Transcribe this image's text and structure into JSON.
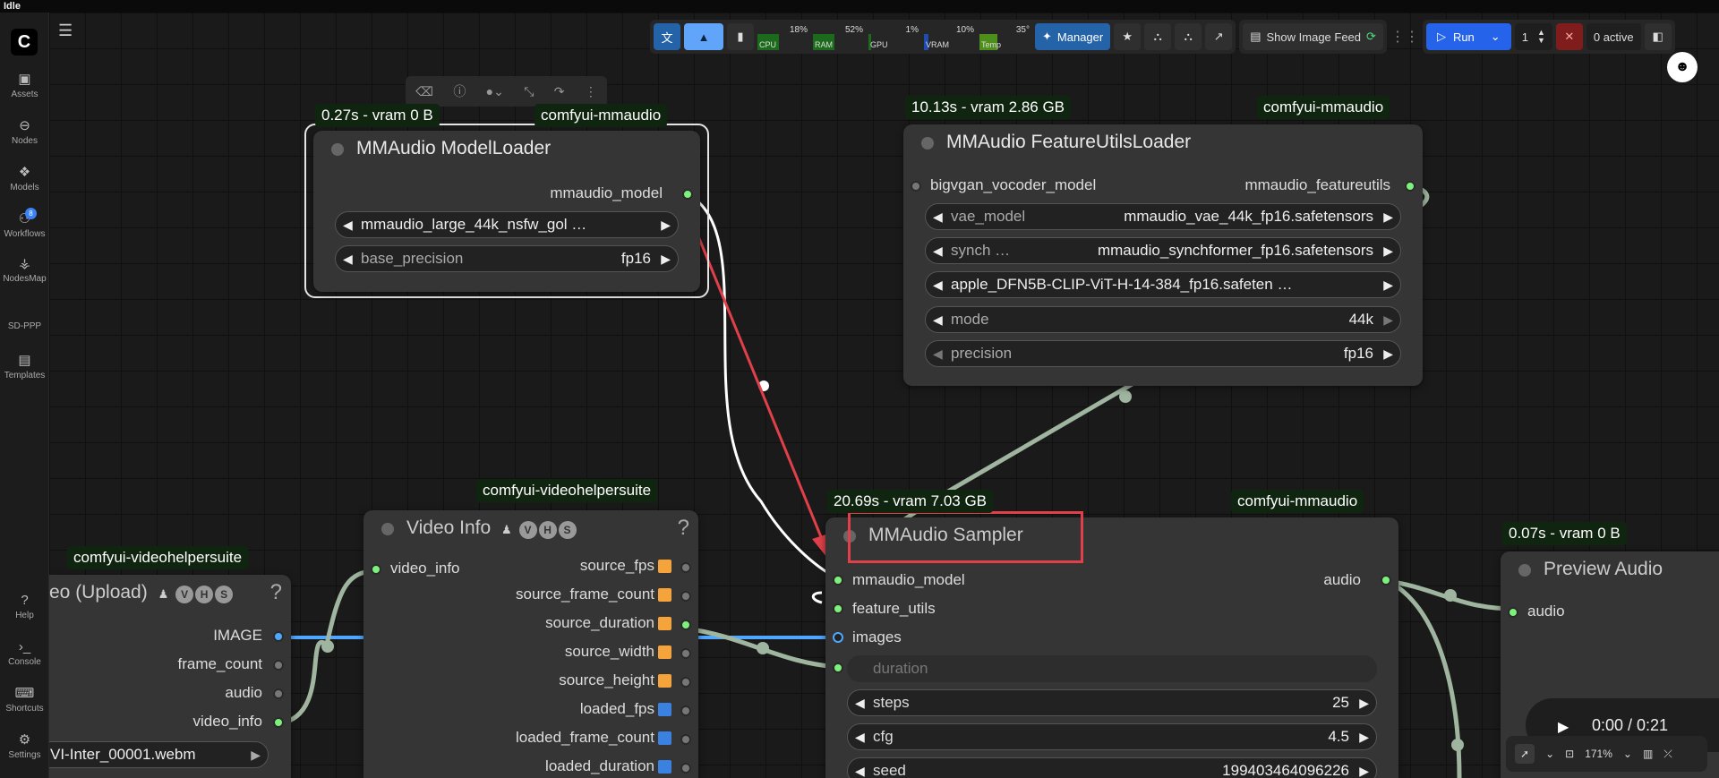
{
  "window": {
    "title": "Idle"
  },
  "sidebar": {
    "logo": "C",
    "items": [
      {
        "label": "Assets",
        "icon": "image-icon"
      },
      {
        "label": "Nodes",
        "icon": "nodes-icon"
      },
      {
        "label": "Models",
        "icon": "models-icon"
      },
      {
        "label": "Workflows",
        "icon": "workflows-icon",
        "badge": "8"
      },
      {
        "label": "NodesMap",
        "icon": "nodesmap-icon"
      },
      {
        "label": "SD-PPP",
        "icon": ""
      },
      {
        "label": "Templates",
        "icon": "templates-icon"
      }
    ],
    "bottom": [
      {
        "label": "Help"
      },
      {
        "label": "Console"
      },
      {
        "label": "Shortcuts"
      },
      {
        "label": "Settings"
      }
    ]
  },
  "toolbar": {
    "meters": [
      {
        "label": "CPU",
        "pct": "18%"
      },
      {
        "label": "RAM",
        "pct": "52%"
      },
      {
        "label": "GPU",
        "pct": "1%"
      },
      {
        "label": "VRAM",
        "pct": "10%"
      },
      {
        "label": "Temp",
        "pct": "35°"
      }
    ],
    "manager_label": "Manager",
    "show_image_feed_label": "Show Image Feed",
    "run_label": "Run",
    "queue_count": "1",
    "active_label": "0 active"
  },
  "nodes": {
    "model_loader": {
      "badge_time": "0.27s - vram 0 B",
      "badge_pkg": "comfyui-mmaudio",
      "title": "MMAudio ModelLoader",
      "output": "mmaudio_model",
      "widgets": [
        {
          "name": "",
          "value": "mmaudio_large_44k_nsfw_gol  …"
        },
        {
          "name": "base_precision",
          "value": "fp16"
        }
      ]
    },
    "feature_loader": {
      "badge_time": "10.13s - vram 2.86 GB",
      "badge_pkg": "comfyui-mmaudio",
      "title": "MMAudio FeatureUtilsLoader",
      "input": "bigvgan_vocoder_model",
      "output": "mmaudio_featureutils",
      "widgets": [
        {
          "name": "vae_model",
          "value": "mmaudio_vae_44k_fp16.safetensors"
        },
        {
          "name": "synch …",
          "value": "mmaudio_synchformer_fp16.safetensors"
        },
        {
          "name": "",
          "value": "apple_DFN5B-CLIP-ViT-H-14-384_fp16.safeten  …"
        },
        {
          "name": "mode",
          "value": "44k"
        },
        {
          "name": "precision",
          "value": "fp16"
        }
      ]
    },
    "video_info": {
      "badge_pkg": "comfyui-videohelpersuite",
      "title": "Video Info",
      "input": "video_info",
      "outputs": [
        {
          "label": "source_fps",
          "color": "orange"
        },
        {
          "label": "source_frame_count",
          "color": "orange"
        },
        {
          "label": "source_duration",
          "color": "orange"
        },
        {
          "label": "source_width",
          "color": "orange"
        },
        {
          "label": "source_height",
          "color": "orange"
        },
        {
          "label": "loaded_fps",
          "color": "blue"
        },
        {
          "label": "loaded_frame_count",
          "color": "blue"
        },
        {
          "label": "loaded_duration",
          "color": "blue"
        }
      ]
    },
    "video_upload": {
      "badge_pkg": "comfyui-videohelpersuite",
      "title": "eo (Upload)",
      "outputs": [
        "IMAGE",
        "frame_count",
        "audio",
        "video_info"
      ],
      "widget_value": "VI-Inter_00001.webm"
    },
    "sampler": {
      "badge_time": "20.69s - vram 7.03 GB",
      "badge_pkg": "comfyui-mmaudio",
      "title": "MMAudio Sampler",
      "inputs": [
        "mmaudio_model",
        "feature_utils",
        "images",
        "duration"
      ],
      "output": "audio",
      "widgets": [
        {
          "name": "steps",
          "value": "25"
        },
        {
          "name": "cfg",
          "value": "4.5"
        },
        {
          "name": "seed",
          "value": "199403464096226"
        }
      ]
    },
    "preview_audio": {
      "badge_time": "0.07s - vram 0 B",
      "title": "Preview Audio",
      "input": "audio",
      "player_time": "0:00 / 0:21"
    }
  },
  "zoom": {
    "level": "171%"
  },
  "colors": {
    "highlight": "#e0404a",
    "link_white": "#ffffff",
    "link_green": "#9fb59f",
    "link_blue": "#4fa8ff"
  }
}
